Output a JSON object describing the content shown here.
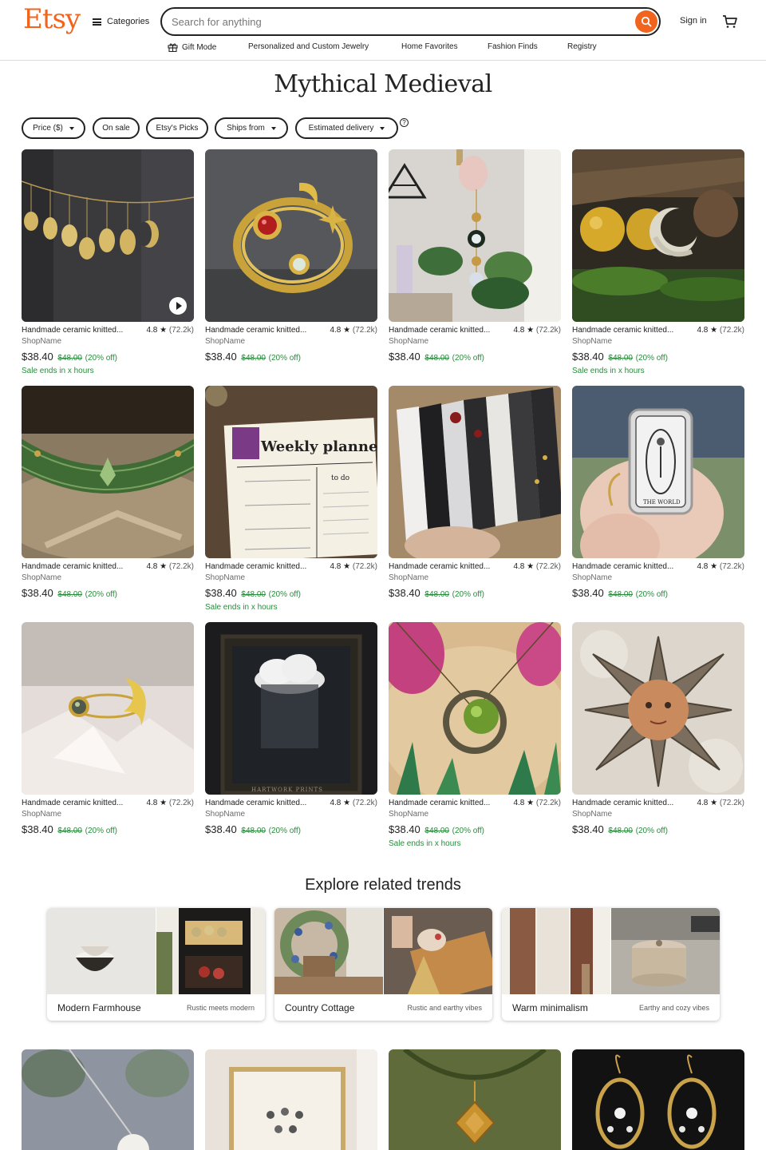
{
  "header": {
    "logo": "Etsy",
    "categories_label": "Categories",
    "search_placeholder": "Search for anything",
    "signin_label": "Sign in"
  },
  "subnav": [
    "Gift Mode",
    "Personalized and Custom Jewelry",
    "Home Favorites",
    "Fashion Finds",
    "Registry"
  ],
  "page_title": "Mythical Medieval",
  "filters": [
    "Price ($)",
    "On sale",
    "Etsy's Picks",
    "Ships from",
    "Estimated delivery"
  ],
  "help_glyph": "?",
  "products": [
    {
      "title": "Handmade ceramic knitted...",
      "rating": "4.8",
      "reviews": "(72.2k)",
      "shop": "ShopName",
      "price": "$38.40",
      "orig": "$48.00",
      "discount": "(20% off)",
      "sale": "Sale ends in x hours",
      "icon": "moon-phase-garland"
    },
    {
      "title": "Handmade ceramic knitted...",
      "rating": "4.8",
      "reviews": "(72.2k)",
      "shop": "ShopName",
      "price": "$38.40",
      "orig": "$48.00",
      "discount": "(20% off)",
      "sale": "",
      "icon": "gold-ring-garnet"
    },
    {
      "title": "Handmade ceramic knitted...",
      "rating": "4.8",
      "reviews": "(72.2k)",
      "shop": "ShopName",
      "price": "$38.40",
      "orig": "$48.00",
      "discount": "(20% off)",
      "sale": "",
      "icon": "suncatcher"
    },
    {
      "title": "Handmade ceramic knitted...",
      "rating": "4.8",
      "reviews": "(72.2k)",
      "shop": "ShopName",
      "price": "$38.40",
      "orig": "$48.00",
      "discount": "(20% off)",
      "sale": "Sale ends in x hours",
      "icon": "moon-pin"
    },
    {
      "title": "Handmade ceramic knitted...",
      "rating": "4.8",
      "reviews": "(72.2k)",
      "shop": "ShopName",
      "price": "$38.40",
      "orig": "$48.00",
      "discount": "(20% off)",
      "sale": "",
      "icon": "leather-circlet"
    },
    {
      "title": "Handmade ceramic knitted...",
      "rating": "4.8",
      "reviews": "(72.2k)",
      "shop": "ShopName",
      "price": "$38.40",
      "orig": "$48.00",
      "discount": "(20% off)",
      "sale": "Sale ends in x hours",
      "icon": "weekly-planner"
    },
    {
      "title": "Handmade ceramic knitted...",
      "rating": "4.8",
      "reviews": "(72.2k)",
      "shop": "ShopName",
      "price": "$38.40",
      "orig": "$48.00",
      "discount": "(20% off)",
      "sale": "",
      "icon": "bookmarks"
    },
    {
      "title": "Handmade ceramic knitted...",
      "rating": "4.8",
      "reviews": "(72.2k)",
      "shop": "ShopName",
      "price": "$38.40",
      "orig": "$48.00",
      "discount": "(20% off)",
      "sale": "",
      "icon": "tarot-ring"
    },
    {
      "title": "Handmade ceramic knitted...",
      "rating": "4.8",
      "reviews": "(72.2k)",
      "shop": "ShopName",
      "price": "$38.40",
      "orig": "$48.00",
      "discount": "(20% off)",
      "sale": "",
      "icon": "moon-ring"
    },
    {
      "title": "Handmade ceramic knitted...",
      "rating": "4.8",
      "reviews": "(72.2k)",
      "shop": "ShopName",
      "price": "$38.40",
      "orig": "$48.00",
      "discount": "(20% off)",
      "sale": "",
      "icon": "cloud-painting"
    },
    {
      "title": "Handmade ceramic knitted...",
      "rating": "4.8",
      "reviews": "(72.2k)",
      "shop": "ShopName",
      "price": "$38.40",
      "orig": "$48.00",
      "discount": "(20% off)",
      "sale": "Sale ends in x hours",
      "icon": "moon-pendant"
    },
    {
      "title": "Handmade ceramic knitted...",
      "rating": "4.8",
      "reviews": "(72.2k)",
      "shop": "ShopName",
      "price": "$38.40",
      "orig": "$48.00",
      "discount": "(20% off)",
      "sale": "",
      "icon": "sun-brooch"
    }
  ],
  "painting_caption": "HARTWORK PRINTS",
  "planner_text": "Weekly planner",
  "planner_todo": "to do",
  "tarot_text": "THE WORLD",
  "trends_title": "Explore related trends",
  "trends": [
    {
      "name": "Modern Farmhouse",
      "sub": "Rustic meets modern"
    },
    {
      "name": "Country Cottage",
      "sub": "Rustic and earthy vibes"
    },
    {
      "name": "Warm minimalism",
      "sub": "Earthy and cozy vibes"
    }
  ],
  "colors": {
    "brand": "#f1641e",
    "sale_green": "#2b8a3e"
  }
}
